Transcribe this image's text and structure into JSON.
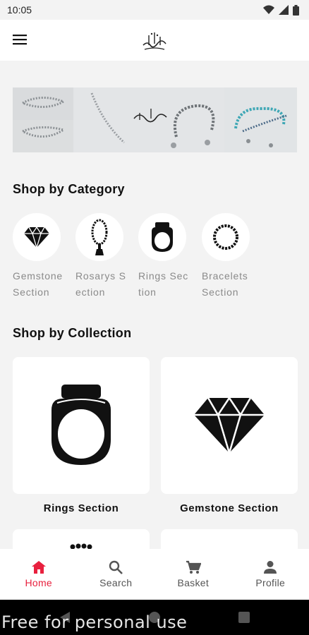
{
  "status_bar": {
    "time": "10:05"
  },
  "header": {
    "menu_icon": "hamburger-menu-icon",
    "logo_icon": "calligraphy-logo-icon"
  },
  "banner": {
    "description_icon": "rosary-banner-image"
  },
  "category_section": {
    "title": "Shop by Category",
    "items": [
      {
        "label": "Gemstone Section",
        "icon": "gem-icon"
      },
      {
        "label": "Rosarys Section",
        "icon": "rosary-icon"
      },
      {
        "label": "Rings Section",
        "icon": "ring-icon"
      },
      {
        "label": "Bracelets Section",
        "icon": "bracelet-icon"
      }
    ]
  },
  "collection_section": {
    "title": "Shop by Collection",
    "items": [
      {
        "label": "Rings Section",
        "icon": "ring-icon"
      },
      {
        "label": "Gemstone Section",
        "icon": "gem-icon"
      }
    ]
  },
  "bottom_nav": {
    "items": [
      {
        "label": "Home",
        "icon": "home-icon",
        "active": true
      },
      {
        "label": "Search",
        "icon": "search-icon",
        "active": false
      },
      {
        "label": "Basket",
        "icon": "cart-icon",
        "active": false
      },
      {
        "label": "Profile",
        "icon": "person-icon",
        "active": false
      }
    ]
  },
  "watermark": {
    "text": "Free for personal use"
  },
  "colors": {
    "accent": "#e8203e",
    "background": "#f3f3f3",
    "card": "#ffffff",
    "muted_text": "#8a8a8a"
  }
}
